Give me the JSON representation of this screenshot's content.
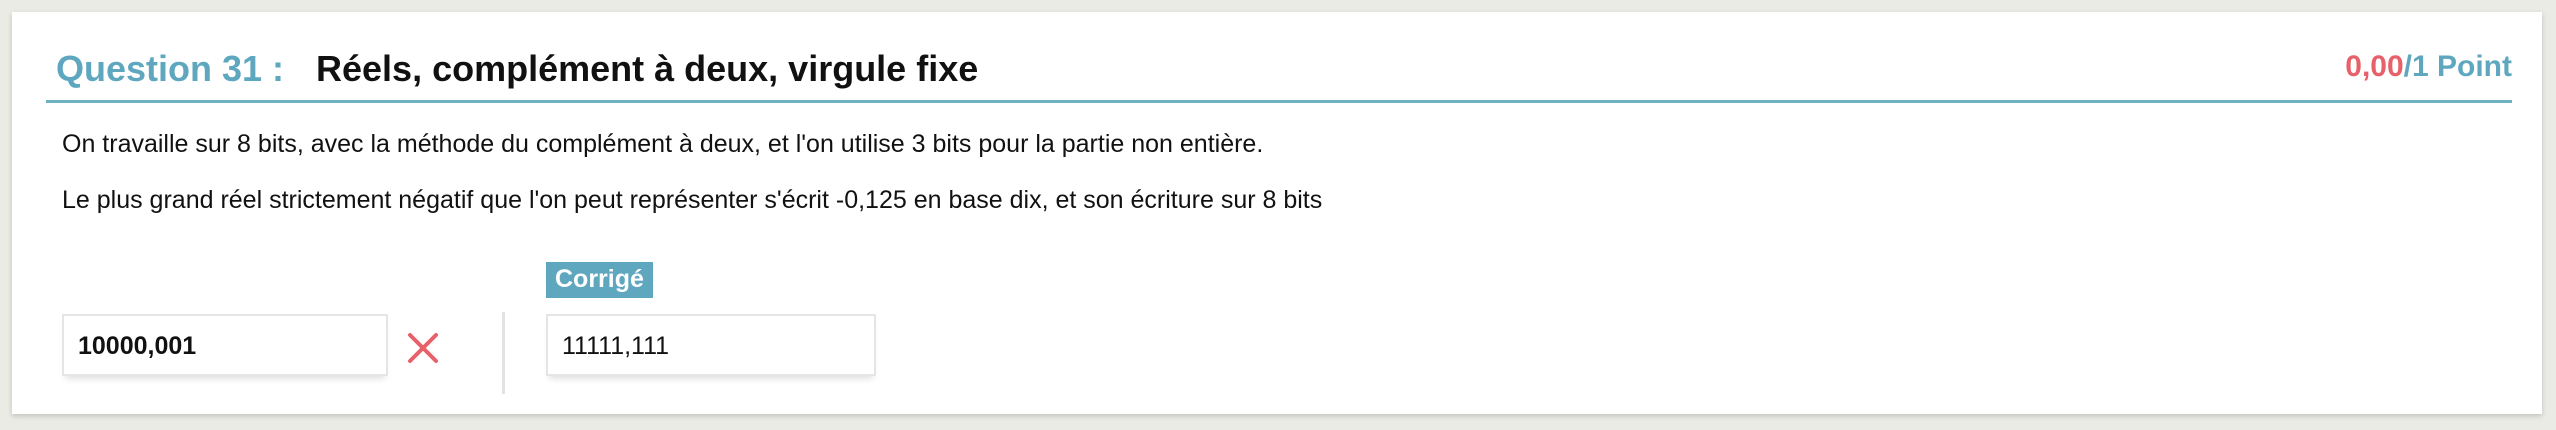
{
  "question": {
    "label": "Question 31 :",
    "title": "Réels, complément à deux, virgule fixe",
    "score_obtained": "0,00",
    "score_total": "/1 Point"
  },
  "statement": {
    "line1": "On travaille sur 8 bits, avec la méthode du complément à deux, et l'on utilise 3 bits pour la partie non entière.",
    "line2": "Le plus grand réel strictement négatif que l'on peut représenter s'écrit -0,125 en base dix, et son écriture sur 8 bits"
  },
  "answer": {
    "user_value": "10000,001",
    "status_icon": "cross-icon",
    "corrige_label": "Corrigé",
    "correct_value": "11111,111"
  },
  "colors": {
    "accent": "#5ea7bf",
    "error": "#e8606a"
  }
}
